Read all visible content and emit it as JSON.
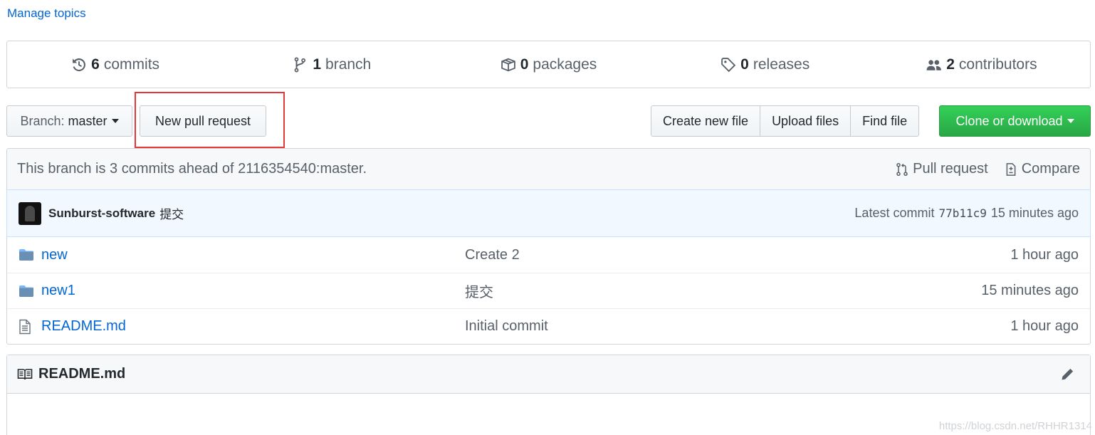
{
  "manage_topics": "Manage topics",
  "summary": [
    {
      "count": "6",
      "label": "commits",
      "icon": "history-icon"
    },
    {
      "count": "1",
      "label": "branch",
      "icon": "git-branch-icon"
    },
    {
      "count": "0",
      "label": "packages",
      "icon": "package-icon"
    },
    {
      "count": "0",
      "label": "releases",
      "icon": "tag-icon"
    },
    {
      "count": "2",
      "label": "contributors",
      "icon": "people-icon"
    }
  ],
  "toolbar": {
    "branch_prefix": "Branch:",
    "branch_name": "master",
    "new_pull_request": "New pull request",
    "create_new_file": "Create new file",
    "upload_files": "Upload files",
    "find_file": "Find file",
    "clone_or_download": "Clone or download",
    "highlight_color": "#e5383b"
  },
  "branch_info": {
    "text": "This branch is 3 commits ahead of 2116354540:master.",
    "pull_request": "Pull request",
    "compare": "Compare"
  },
  "commit": {
    "author": "Sunburst-software",
    "message": "提交",
    "latest_label": "Latest commit",
    "sha": "77b11c9",
    "age": "15 minutes ago"
  },
  "files": [
    {
      "type": "directory",
      "name": "new",
      "message": "Create 2",
      "age": "1 hour ago"
    },
    {
      "type": "directory",
      "name": "new1",
      "message": "提交",
      "age": "15 minutes ago"
    },
    {
      "type": "file",
      "name": "README.md",
      "message": "Initial commit",
      "age": "1 hour ago"
    }
  ],
  "readme": {
    "title": "README.md"
  },
  "watermark": "https://blog.csdn.net/RHHR1314"
}
